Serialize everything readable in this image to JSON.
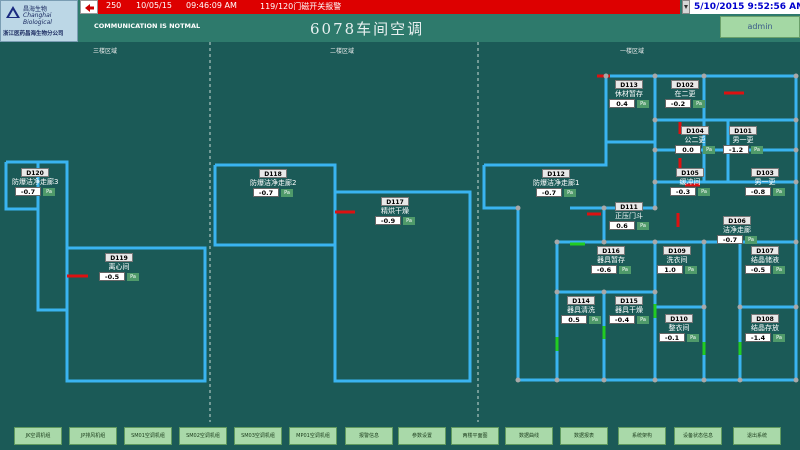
{
  "header": {
    "logo_cn": "昌海生物",
    "logo_en": "Changhai Biological",
    "logo_sub": "浙江医药昌海生物分公司",
    "alarm": {
      "count": "250",
      "date": "10/05/15",
      "time": "09:46:09 AM",
      "message": "119/120门磁开关报警"
    },
    "datetime": "5/10/2015 9:52:56 AM",
    "comm_status": "COMMUNICATION IS NOTMAL",
    "title": "6078车间空调",
    "user": "admin"
  },
  "zones": [
    "三楼区域",
    "二楼区域",
    "一楼区域"
  ],
  "unit": "Pa",
  "rooms": [
    {
      "id": "D120",
      "name": "防爆洁净走廊3",
      "value": "-0.7"
    },
    {
      "id": "D119",
      "name": "离心间",
      "value": "-0.5"
    },
    {
      "id": "D118",
      "name": "防爆洁净走廊2",
      "value": "-0.7"
    },
    {
      "id": "D117",
      "name": "精烘干燥",
      "value": "-0.9"
    },
    {
      "id": "D112",
      "name": "防爆洁净走廊1",
      "value": "-0.7"
    },
    {
      "id": "D113",
      "name": "休材暂存",
      "value": "0.4"
    },
    {
      "id": "D102",
      "name": "在二更",
      "value": "-0.2"
    },
    {
      "id": "D104",
      "name": "公二更",
      "value": "0.0"
    },
    {
      "id": "D101",
      "name": "男一更",
      "value": "-1.2"
    },
    {
      "id": "D105",
      "name": "缓冲间",
      "value": "-0.3"
    },
    {
      "id": "D103",
      "name": "男一更",
      "value": "-0.8"
    },
    {
      "id": "D111",
      "name": "正压门斗",
      "value": "0.6"
    },
    {
      "id": "D106",
      "name": "洁净走廊",
      "value": "-0.7"
    },
    {
      "id": "D116",
      "name": "器具暂存",
      "value": "-0.6"
    },
    {
      "id": "D109",
      "name": "洗衣间",
      "value": "1.0"
    },
    {
      "id": "D107",
      "name": "结晶储液",
      "value": "-0.5"
    },
    {
      "id": "D114",
      "name": "器具清洗",
      "value": "0.5"
    },
    {
      "id": "D115",
      "name": "器具干燥",
      "value": "-0.4"
    },
    {
      "id": "D110",
      "name": "整衣间",
      "value": "-0.1"
    },
    {
      "id": "D108",
      "name": "结晶存放",
      "value": "-1.4"
    }
  ],
  "nav": [
    "JK空调机组",
    "JP排风机组",
    "SM01空调机组",
    "SM02空调机组",
    "SM03空调机组",
    "MP01空调机组",
    "报警信息",
    "参数设置",
    "两楼平面图",
    "数据曲线",
    "数据报表",
    "系统架构",
    "设备状态信息",
    "退出系统"
  ],
  "colors": {
    "background": "#1b5a57",
    "wall": "#3ab4f0",
    "door_red": "#dd1111",
    "door_green": "#22cc22",
    "alarm": "#dd0000",
    "user_box": "#a4d8a4",
    "nav_button": "#a9d9a9"
  }
}
